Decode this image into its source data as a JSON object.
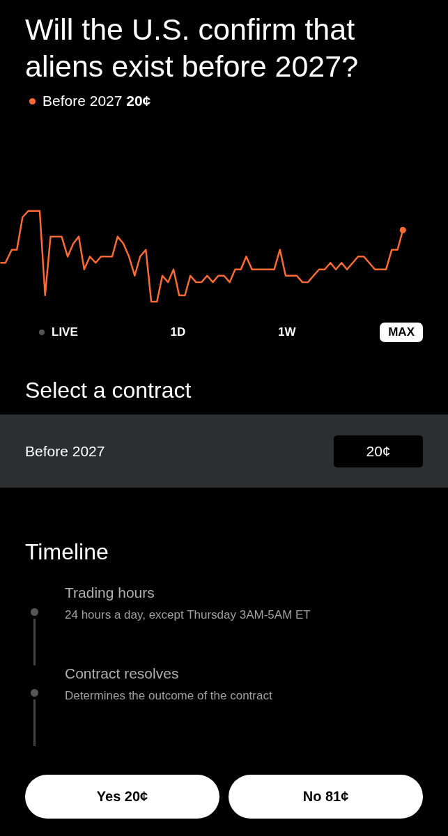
{
  "title": "Will the U.S. confirm that aliens exist before 2027?",
  "legend": {
    "label": "Before 2027",
    "value": "20¢",
    "color": "#ff6b35"
  },
  "ranges": [
    {
      "label": "LIVE",
      "kind": "live",
      "selected": false
    },
    {
      "label": "1D",
      "kind": "plain",
      "selected": false
    },
    {
      "label": "1W",
      "kind": "plain",
      "selected": false
    },
    {
      "label": "MAX",
      "kind": "plain",
      "selected": true
    }
  ],
  "contracts": {
    "heading": "Select a contract",
    "rows": [
      {
        "name": "Before 2027",
        "price": "20¢",
        "selected": true
      }
    ]
  },
  "timeline": {
    "heading": "Timeline",
    "items": [
      {
        "title": "Trading hours",
        "detail": "24 hours a day, except Thursday 3AM-5AM ET"
      },
      {
        "title": "Contract resolves",
        "detail": "Determines the outcome of the contract"
      }
    ]
  },
  "buttons": [
    {
      "label": "Yes 20¢"
    },
    {
      "label": "No 81¢"
    }
  ]
}
